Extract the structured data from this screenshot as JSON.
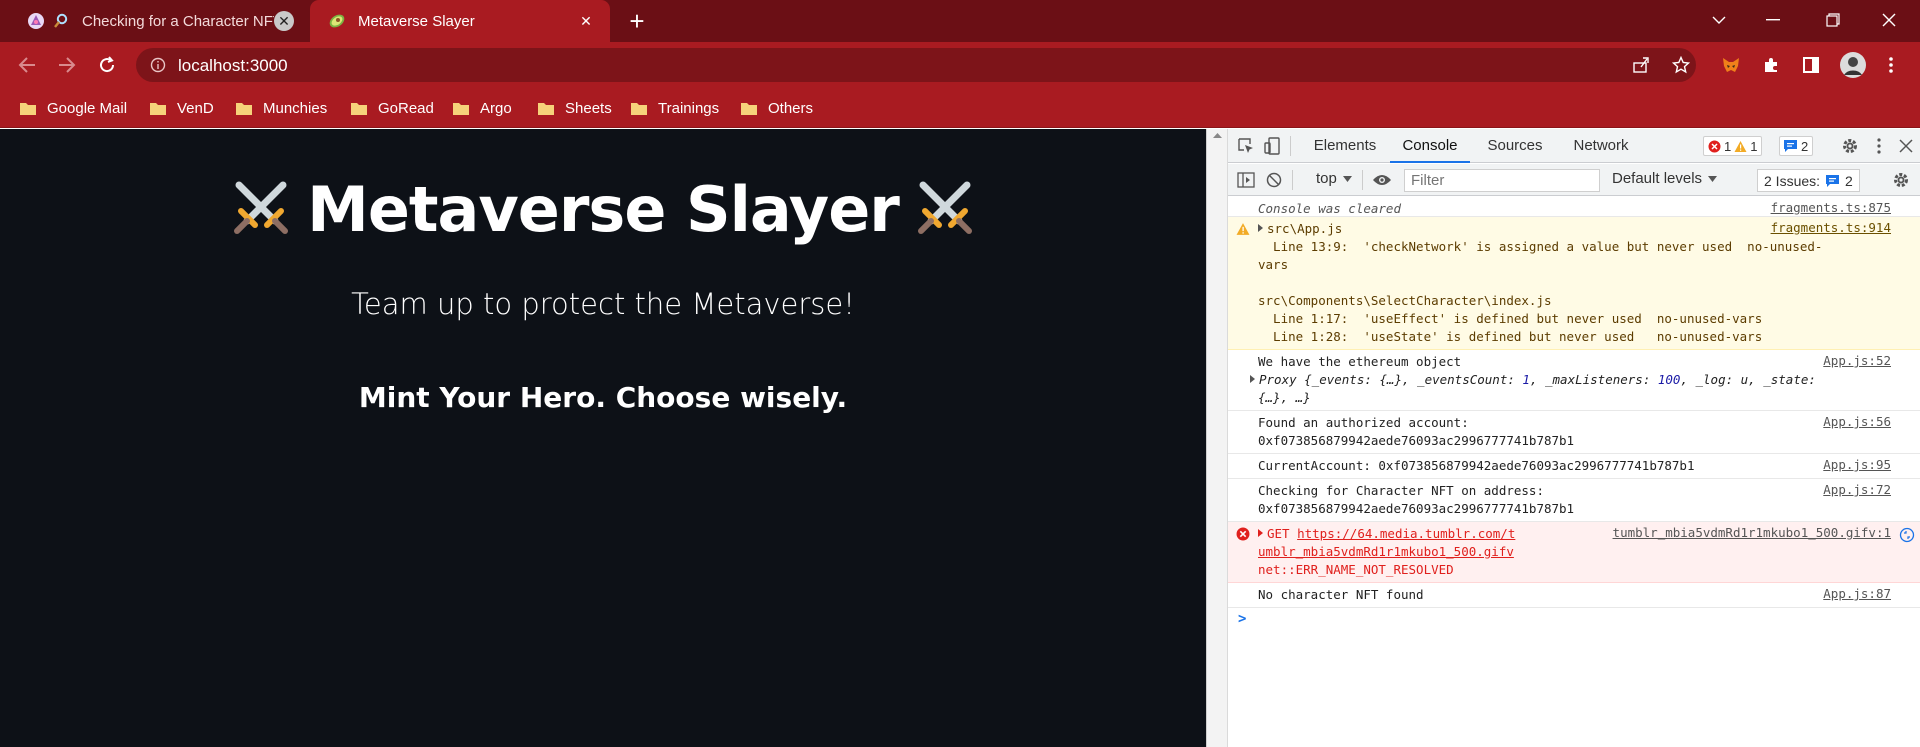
{
  "browser": {
    "tabs": [
      {
        "title": "Checking for a Character NFT",
        "active": false
      },
      {
        "title": "Metaverse Slayer",
        "active": true
      }
    ],
    "url": "localhost:3000",
    "bookmarks": [
      "Google Mail",
      "VenD",
      "Munchies",
      "GoRead",
      "Argo",
      "Sheets",
      "Trainings",
      "Others"
    ],
    "colors": {
      "frame": "#6b0f15",
      "toolbar": "#a91b21",
      "omnibox": "#7d1419",
      "page_bg": "#0d1117"
    }
  },
  "page": {
    "title": "Metaverse Slayer",
    "subtitle": "Team up to protect the Metaverse!",
    "mint_heading": "Mint Your Hero. Choose wisely."
  },
  "devtools": {
    "tabs": [
      "Elements",
      "Console",
      "Sources",
      "Network"
    ],
    "active_tab": "Console",
    "error_count": "1",
    "warning_count": "1",
    "issue_count": "2",
    "context": "top",
    "filter_placeholder": "Filter",
    "levels": "Default levels",
    "issues_label": "2 Issues:",
    "issues_badge": "2",
    "console": {
      "cleared": {
        "text": "Console was cleared",
        "source": "fragments.ts:875"
      },
      "warning": {
        "source": "fragments.ts:914",
        "file1": "src\\App.js",
        "lines": "  Line 13:9:  'checkNetwork' is assigned a value but never used  no-unused-\nvars\n\nsrc\\Components\\SelectCharacter\\index.js\n  Line 1:17:  'useEffect' is defined but never used  no-unused-vars\n  Line 1:28:  'useState' is defined but never used   no-unused-vars"
      },
      "ethereum": {
        "text": "We have the ethereum object",
        "source": "App.js:52",
        "proxy_a": "Proxy {_events: {…}, _eventsCount: ",
        "events_count": "1",
        "proxy_b": ", _maxListeners: ",
        "max_listeners": "100",
        "proxy_c": ", _log: u, _state:",
        "proxy_d": "{…}, …}"
      },
      "authorized": {
        "line1": "Found an authorized account:",
        "line2": "0xf073856879942aede76093ac2996777741b787b1",
        "source": "App.js:56"
      },
      "current": {
        "text": "CurrentAccount: 0xf073856879942aede76093ac2996777741b787b1",
        "source": "App.js:95"
      },
      "checking": {
        "line1": "Checking for Character NFT on address:",
        "line2": "0xf073856879942aede76093ac2996777741b787b1",
        "source": "App.js:72"
      },
      "error": {
        "method": "GET",
        "url_a": "https://64.media.tumblr.com/t",
        "url_b": "umblr_mbia5vdmRd1r1mkubo1_500.gifv",
        "source": "tumblr_mbia5vdmRd1r1mkubo1_500.gifv:1",
        "detail": "net::ERR_NAME_NOT_RESOLVED"
      },
      "no_nft": {
        "text": "No character NFT found",
        "source": "App.js:87"
      },
      "prompt": ">"
    }
  }
}
